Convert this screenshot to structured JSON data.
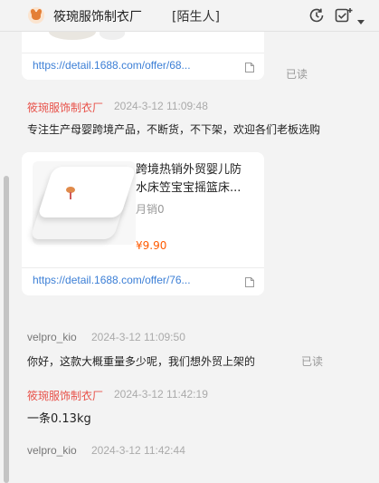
{
  "header": {
    "title": "筱琬服饰制衣厂",
    "tag": "[陌生人]",
    "icons": [
      "refresh-clock-icon",
      "checkbox-plus-icon",
      "dropdown-arrow-icon"
    ]
  },
  "messages": {
    "card1": {
      "link": "https://detail.1688.com/offer/68...",
      "status": "已读"
    },
    "msg1": {
      "sender": "筱琬服饰制衣厂",
      "time": "2024-3-12 11:09:48",
      "text": "专注生产母婴跨境产品，不断货，不下架，欢迎各们老板选购"
    },
    "card2": {
      "title_line1": "跨境热销外贸婴儿防",
      "title_line2": "水床笠宝宝摇篮床...",
      "sales": "月销0",
      "price": "¥9.90",
      "link": "https://detail.1688.com/offer/76..."
    },
    "msg2": {
      "sender": "velpro_kio",
      "time": "2024-3-12 11:09:50",
      "text": "你好，这款大概重量多少呢，我们想外贸上架的",
      "status": "已读"
    },
    "msg3": {
      "sender": "筱琬服饰制衣厂",
      "time": "2024-3-12 11:42:19",
      "text": "一条0.13kg"
    },
    "msg4": {
      "sender": "velpro_kio",
      "time": "2024-3-12 11:42:44"
    }
  },
  "colors": {
    "shop_sender": "#e8524a",
    "link": "#3c7fd6",
    "price": "#ff5a00"
  }
}
